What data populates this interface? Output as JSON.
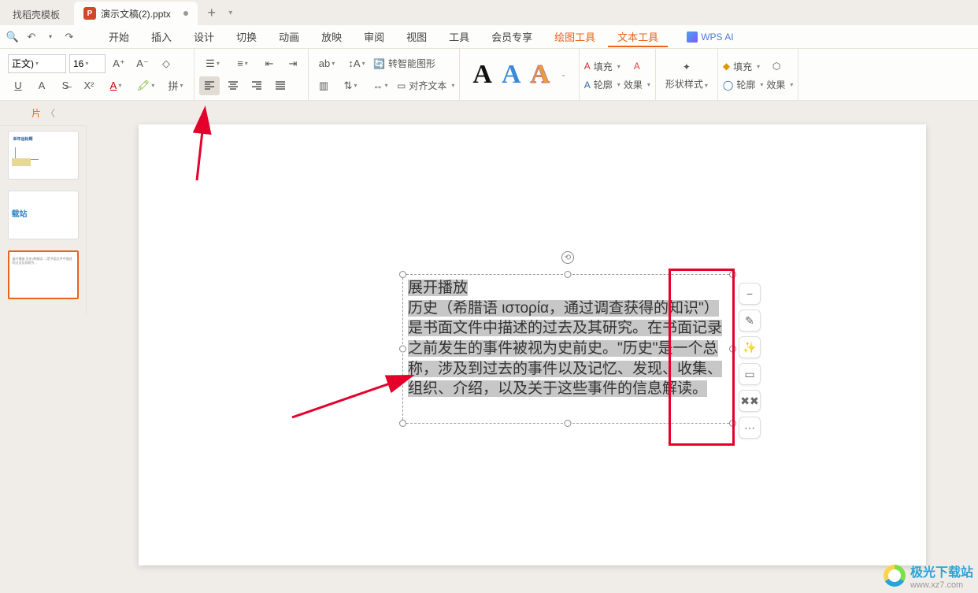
{
  "tabs": {
    "template": "找稻壳模板",
    "file": "演示文稿(2).pptx"
  },
  "menu": {
    "items": [
      "开始",
      "插入",
      "设计",
      "切换",
      "动画",
      "放映",
      "审阅",
      "视图",
      "工具",
      "会员专享",
      "绘图工具",
      "文本工具"
    ],
    "ai": "WPS AI"
  },
  "ribbon": {
    "font_name": "正文)",
    "font_size": "16",
    "convert_smart": "转智能图形",
    "align_text": "对齐文本",
    "fill": "填充",
    "outline": "轮廓",
    "effect": "效果",
    "shape_style": "形状样式"
  },
  "outline": {
    "label": "片"
  },
  "textbox": {
    "line1": "展开播放",
    "body": "历史（希腊语 ιστορία，通过调查获得的知识\"）是书面文件中描述的过去及其研究。在书面记录之前发生的事件被视为史前史。\"历史\"是一个总称，涉及到过去的事件以及记忆、发现、收集、组织、介绍，以及关于这些事件的信息解读。"
  },
  "watermark": {
    "name": "极光下载站",
    "url": "www.xz7.com"
  },
  "thumbs": {
    "t1_title": "单年运标题",
    "t2_logo": "载站"
  }
}
